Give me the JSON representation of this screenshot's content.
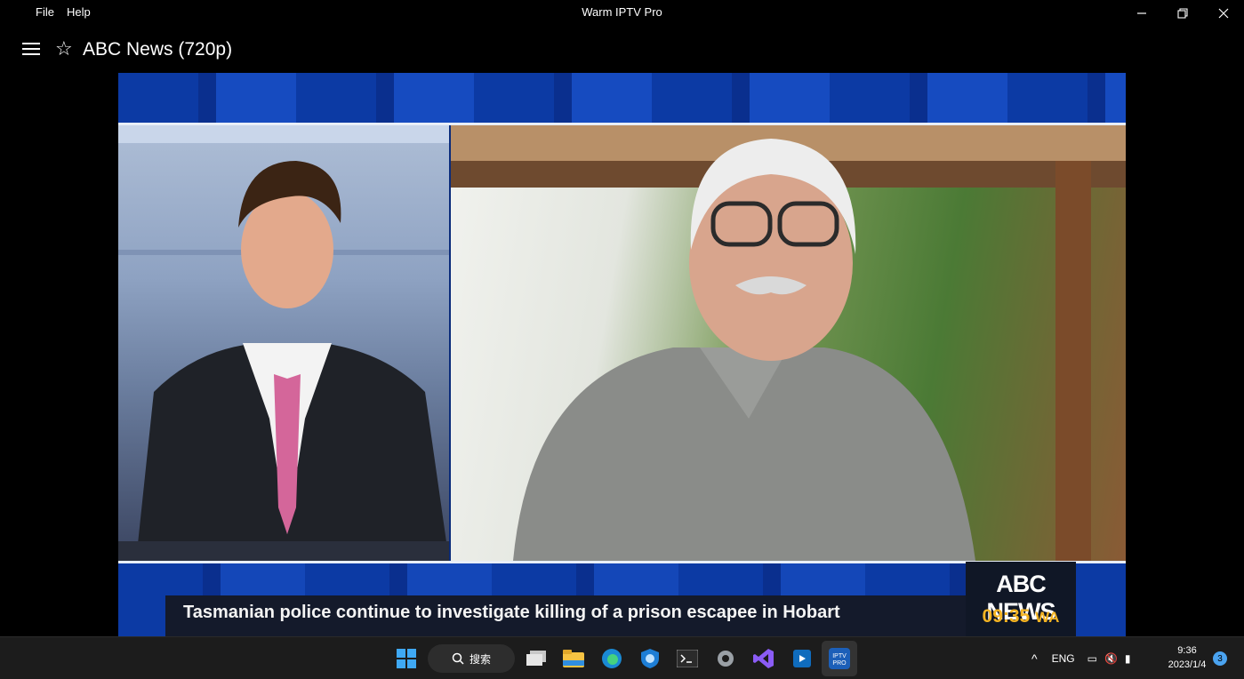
{
  "window": {
    "title": "Warm IPTV Pro",
    "menu": [
      "File",
      "Help"
    ]
  },
  "header": {
    "channel_title": "ABC News (720p)"
  },
  "video": {
    "ticker_text": "Tasmanian police continue to investigate killing of a prison escapee in Hobart",
    "logo_text": "ABC NEWS",
    "on_screen_time": "09:35",
    "time_zone": "WA"
  },
  "taskbar": {
    "search_label": "搜索",
    "language": "ENG",
    "time": "9:36",
    "date": "2023/1/4",
    "notification_count": "3"
  },
  "colors": {
    "accent_clock": "#f5b422",
    "abc_blue": "#0c3aa4"
  }
}
